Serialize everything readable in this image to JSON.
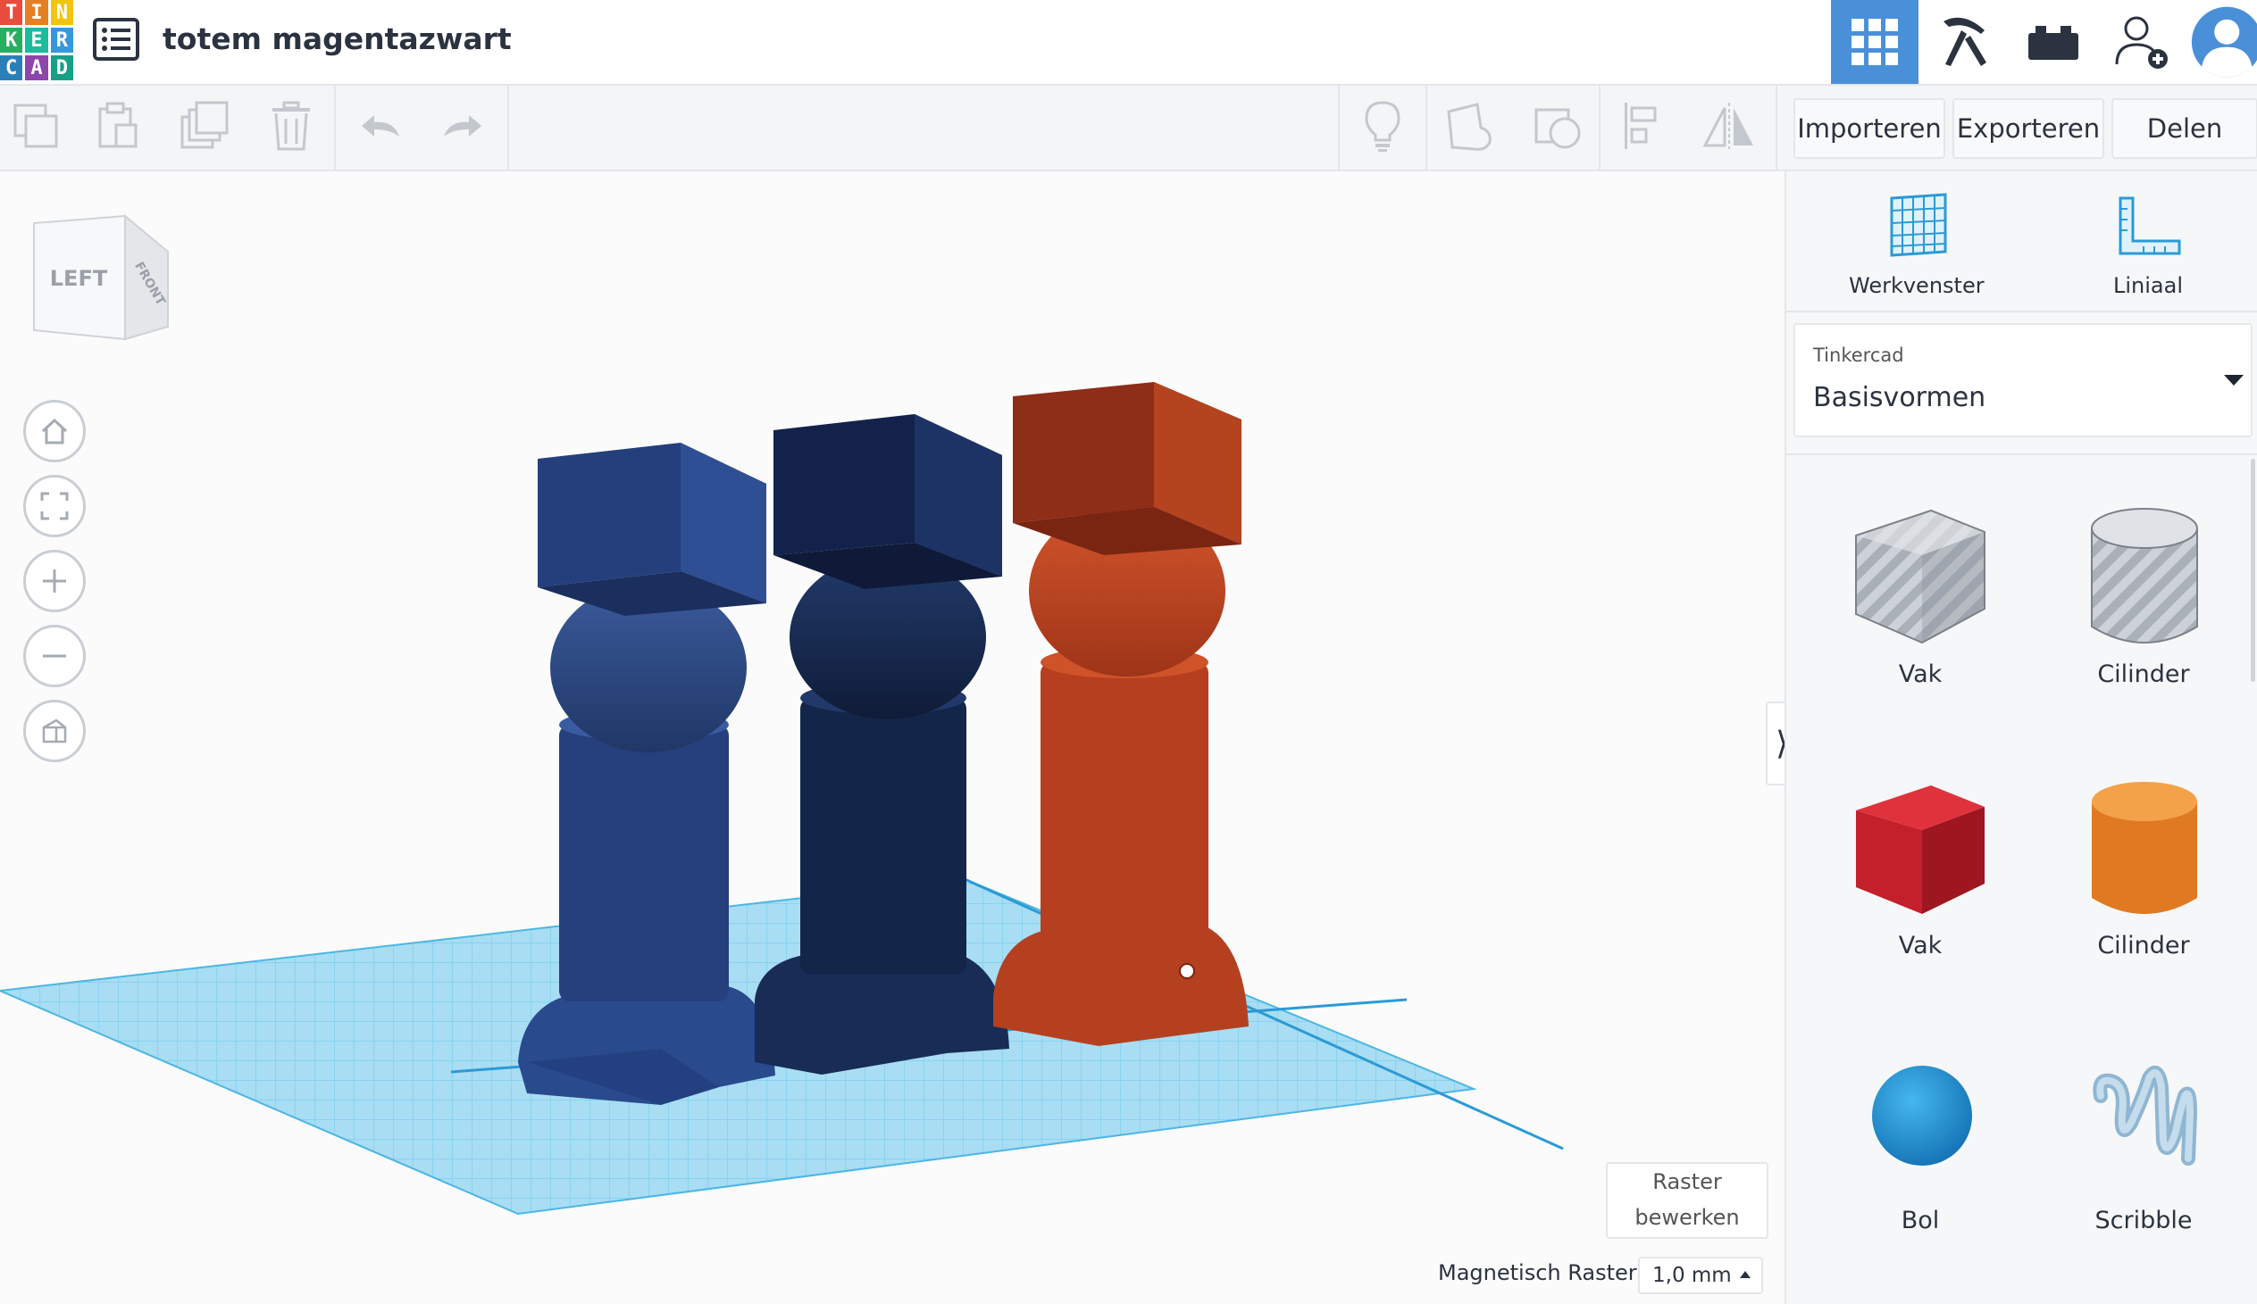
{
  "app": {
    "logo_letters": [
      "T",
      "I",
      "N",
      "K",
      "E",
      "R",
      "C",
      "A",
      "D"
    ],
    "logo_colors": [
      "#e74c3c",
      "#e67e22",
      "#f1c40f",
      "#27ae60",
      "#1abc9c",
      "#3498db",
      "#2980b9",
      "#8e44ad",
      "#16a085"
    ],
    "title": "totem magentazwart"
  },
  "topbar": {
    "buttons": [
      {
        "name": "3d-design-view",
        "icon": "grid-icon",
        "active": true
      },
      {
        "name": "codeblocks-view",
        "icon": "pickaxe-icon",
        "active": false
      },
      {
        "name": "bricks-view",
        "icon": "brick-icon",
        "active": false
      },
      {
        "name": "invite-user",
        "icon": "add-user-icon",
        "active": false
      },
      {
        "name": "profile",
        "icon": "avatar-icon",
        "active": false
      }
    ],
    "accent_color": "#4a90d9"
  },
  "toolbar": {
    "import_label": "Importeren",
    "export_label": "Exporteren",
    "share_label": "Delen"
  },
  "panel": {
    "workplane_label": "Werkvenster",
    "ruler_label": "Liniaal",
    "library_caption": "Tinkercad",
    "library_value": "Basisvormen",
    "shapes": [
      {
        "label": "Vak",
        "kind": "box-hole"
      },
      {
        "label": "Cilinder",
        "kind": "cylinder-hole"
      },
      {
        "label": "Vak",
        "kind": "box-red"
      },
      {
        "label": "Cilinder",
        "kind": "cylinder-orange"
      },
      {
        "label": "Bol",
        "kind": "sphere-blue"
      },
      {
        "label": "Scribble",
        "kind": "scribble"
      }
    ]
  },
  "viewcube": {
    "left_label": "LEFT",
    "front_label": "FRONT"
  },
  "bottom": {
    "edit_grid_line1": "Raster",
    "edit_grid_line2": "bewerken",
    "snap_label": "Magnetisch Raster",
    "snap_value": "1,0 mm"
  }
}
